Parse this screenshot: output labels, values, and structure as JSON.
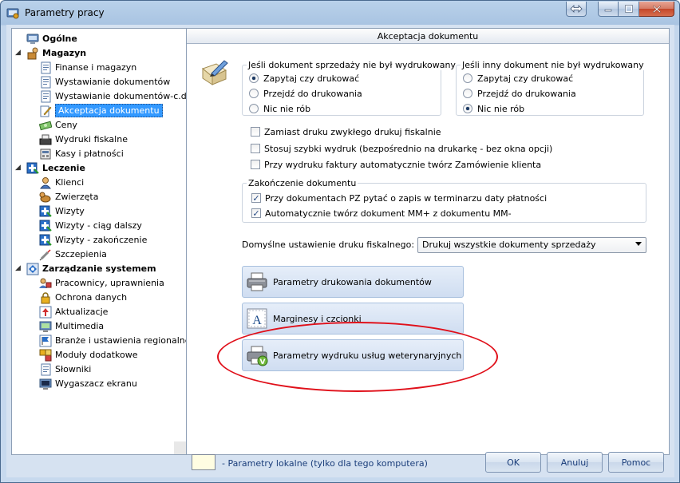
{
  "window": {
    "title": "Parametry pracy"
  },
  "tree": {
    "items": [
      {
        "label": "Ogólne"
      },
      {
        "label": "Magazyn"
      },
      {
        "label": "Finanse i magazyn"
      },
      {
        "label": "Wystawianie dokumentów"
      },
      {
        "label": "Wystawianie dokumentów-c.d."
      },
      {
        "label": "Akceptacja dokumentu"
      },
      {
        "label": "Ceny"
      },
      {
        "label": "Wydruki fiskalne"
      },
      {
        "label": "Kasy i płatności"
      },
      {
        "label": "Leczenie"
      },
      {
        "label": "Klienci"
      },
      {
        "label": "Zwierzęta"
      },
      {
        "label": "Wizyty"
      },
      {
        "label": "Wizyty - ciąg dalszy"
      },
      {
        "label": "Wizyty - zakończenie"
      },
      {
        "label": "Szczepienia"
      },
      {
        "label": "Zarządzanie systemem"
      },
      {
        "label": "Pracownicy, uprawnienia"
      },
      {
        "label": "Ochrona danych"
      },
      {
        "label": "Aktualizacje"
      },
      {
        "label": "Multimedia"
      },
      {
        "label": "Branże i ustawienia regionalne"
      },
      {
        "label": "Moduły dodatkowe"
      },
      {
        "label": "Słowniki"
      },
      {
        "label": "Wygaszacz ekranu"
      }
    ]
  },
  "panel": {
    "header": "Akceptacja dokumentu",
    "group_sale": {
      "title": "Jeśli dokument sprzedaży nie był wydrukowany",
      "options": [
        "Zapytaj czy drukować",
        "Przejdź do drukowania",
        "Nic nie rób"
      ],
      "selected_label": "Zapytaj czy drukować"
    },
    "group_other": {
      "title": "Jeśli inny dokument nie był wydrukowany",
      "options": [
        "Zapytaj czy drukować",
        "Przejdź do drukowania",
        "Nic nie rób"
      ],
      "selected_label": "Nic nie rób"
    },
    "checks": [
      {
        "label": "Zamiast druku zwykłego drukuj fiskalnie",
        "checked": false
      },
      {
        "label": "Stosuj szybki wydruk (bezpośrednio na drukarkę - bez okna opcji)",
        "checked": false
      },
      {
        "label": "Przy wydruku faktury automatycznie twórz Zamówienie klienta",
        "checked": false
      }
    ],
    "group_close": {
      "title": "Zakończenie dokumentu",
      "checks": [
        {
          "label": "Przy dokumentach PZ pytać o zapis w terminarzu daty płatności",
          "checked": true
        },
        {
          "label": "Automatycznie twórz dokument MM+ z dokumentu MM-",
          "checked": true
        }
      ]
    },
    "fiscal": {
      "label": "Domyślne ustawienie druku fiskalnego:",
      "value": "Drukuj wszystkie dokumenty sprzedaży"
    },
    "buttons": [
      {
        "label": "Parametry drukowania dokumentów"
      },
      {
        "label": "Marginesy i czcionki"
      },
      {
        "label": "Parametry wydruku usług weterynaryjnych"
      }
    ]
  },
  "footer": {
    "legend": "- Parametry lokalne (tylko dla tego komputera)",
    "ok": "OK",
    "cancel": "Anuluj",
    "help": "Pomoc"
  },
  "colors": {
    "selection": "#3399ff",
    "highlight_ellipse": "#e0101a",
    "legend_swatch": "#fffde2"
  }
}
